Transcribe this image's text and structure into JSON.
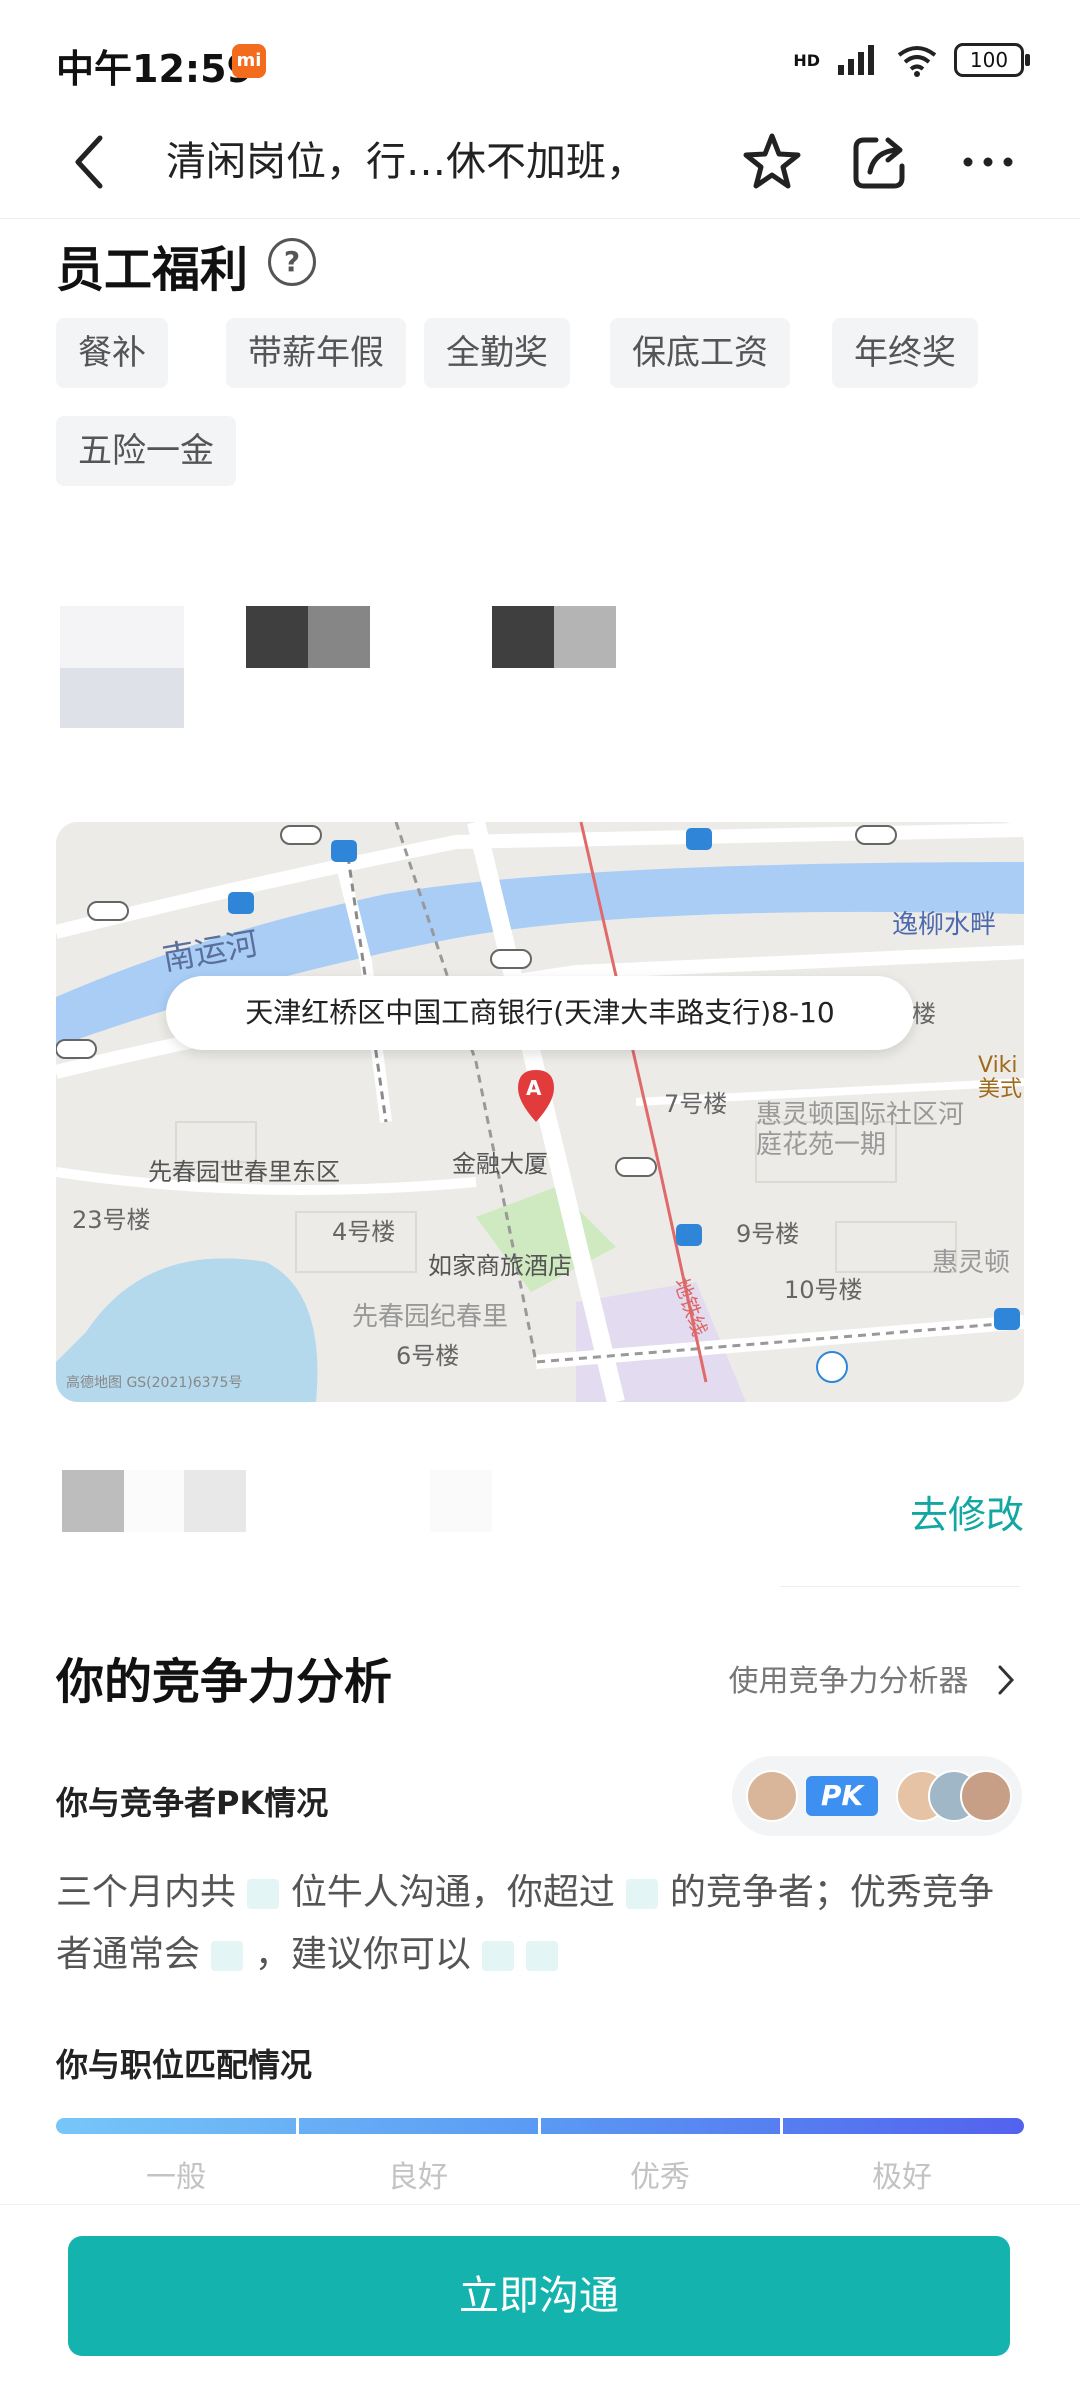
{
  "status_bar": {
    "time": "中午12:59",
    "network": "HD",
    "battery": "100"
  },
  "nav": {
    "title": "清闲岗位，行…休不加班，"
  },
  "benefits": {
    "title": "员工福利",
    "help": "?",
    "tags": [
      "餐补",
      "带薪年假",
      "全勤奖",
      "保底工资",
      "年终奖",
      "五险一金"
    ]
  },
  "map": {
    "address": "天津红桥区中国工商银行(天津大丰路支行)8-10",
    "marker": "A",
    "places": {
      "river": "南运河",
      "yiliu": "逸柳水畔",
      "xianchun_east": "先春园世春里东区",
      "jinrong": "金融大厦",
      "huiling": "惠灵顿国际社区河庭花苑一期",
      "rujia": "如家商旅酒店",
      "xianchun_jichun": "先春园纪春里",
      "b7": "7号楼",
      "b4": "4号楼",
      "b23": "23号楼",
      "b9": "9号楼",
      "b10": "10号楼",
      "b6": "6号楼",
      "louo": "楼",
      "huiling2": "惠灵顿",
      "viki": "Viki\n美式",
      "line": "地铁线",
      "copyright": "高德地图 GS(2021)6375号"
    }
  },
  "location_modify": "去修改",
  "competition": {
    "title": "你的竞争力分析",
    "analyzer_link": "使用竞争力分析器",
    "pk_label": "你与竞争者PK情况",
    "pk_badge": "PK",
    "para_1": "三个月内共",
    "para_2": "位牛人沟通，你超过",
    "para_3": "的竞争者；优秀竞争者通常会",
    "para_4": "，建议你可以",
    "match_label": "你与职位匹配情况",
    "levels": [
      "一般",
      "良好",
      "优秀",
      "极好"
    ]
  },
  "cta": {
    "label": "立即沟通"
  },
  "colors": {
    "accent": "#15b3ae",
    "link": "#12a7a3"
  }
}
